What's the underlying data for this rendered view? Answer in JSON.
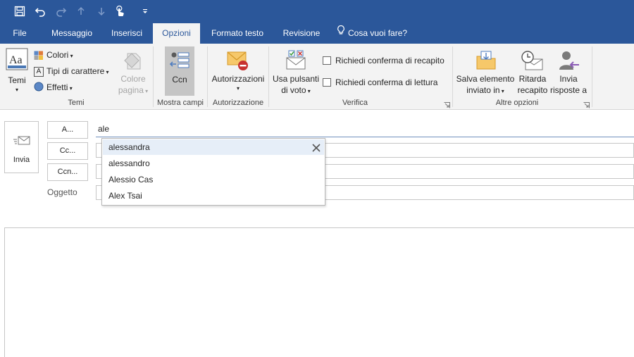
{
  "quick_access": {
    "icons": [
      "save-icon",
      "undo-icon",
      "redo-icon",
      "up-arrow-icon",
      "down-arrow-icon",
      "touch-mode-icon",
      "customize-qat-icon"
    ]
  },
  "tabs": [
    {
      "label": "File"
    },
    {
      "label": "Messaggio"
    },
    {
      "label": "Inserisci"
    },
    {
      "label": "Opzioni"
    },
    {
      "label": "Formato testo"
    },
    {
      "label": "Revisione"
    },
    {
      "label": "Cosa vuoi fare?"
    }
  ],
  "ribbon": {
    "temi": {
      "themes_label": "Temi",
      "colors_label": "Colori",
      "fonts_label": "Tipi di carattere",
      "effects_label": "Effetti",
      "page_color_line1": "Colore",
      "page_color_line2": "pagina",
      "group_label": "Temi"
    },
    "mostra_campi": {
      "bcc_label": "Ccn",
      "group_label": "Mostra campi"
    },
    "autorizzazione": {
      "permission_label": "Autorizzazioni",
      "group_label": "Autorizzazione"
    },
    "verifica": {
      "voting_line1": "Usa pulsanti",
      "voting_line2": "di voto",
      "delivery_receipt": "Richiedi conferma di recapito",
      "read_receipt": "Richiedi conferma di lettura",
      "group_label": "Verifica"
    },
    "altre_opzioni": {
      "save_sent_line1": "Salva elemento",
      "save_sent_line2": "inviato in",
      "delay_line1": "Ritarda",
      "delay_line2": "recapito",
      "reply_line1": "Invia",
      "reply_line2": "risposte a",
      "group_label": "Altre opzioni"
    }
  },
  "compose": {
    "send_label": "Invia",
    "to_button": "A...",
    "cc_button": "Cc...",
    "bcc_button": "Ccn...",
    "subject_label": "Oggetto",
    "to_value": "ale"
  },
  "autocomplete": {
    "suggestions": [
      "alessandra",
      "alessandro",
      "Alessio Cas",
      "Alex Tsai"
    ]
  },
  "colors": {
    "brand": "#2b579a",
    "ribbon_bg": "#f3f3f3",
    "selected_suggestion": "#e6eef8"
  }
}
